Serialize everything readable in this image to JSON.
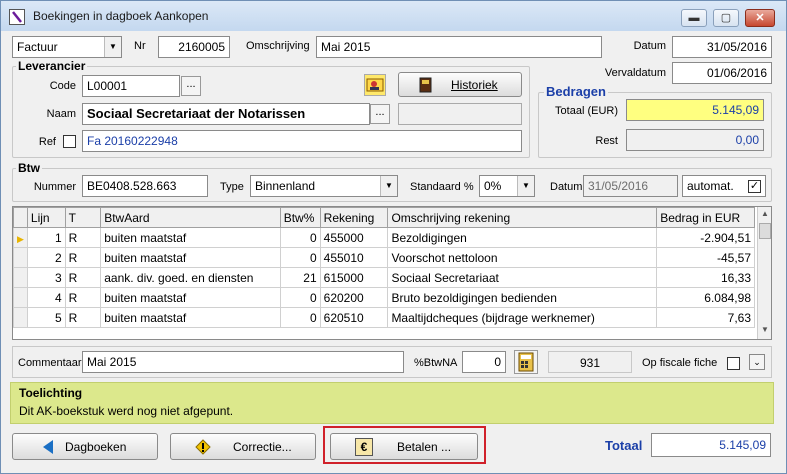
{
  "window": {
    "title": "Boekingen in dagboek Aankopen",
    "minimize": "▬",
    "restore": "▢",
    "close": "✕"
  },
  "header": {
    "doc_type": "Factuur",
    "nr_label": "Nr",
    "nr_value": "2160005",
    "omschrijving_label": "Omschrijving",
    "omschrijving_value": "Mai 2015",
    "datum_label": "Datum",
    "datum_value": "31/05/2016",
    "vervaldatum_label": "Vervaldatum",
    "vervaldatum_value": "01/06/2016"
  },
  "leverancier": {
    "title": "Leverancier",
    "code_label": "Code",
    "code_value": "L00001",
    "naam_label": "Naam",
    "naam_value": "Sociaal Secretariaat der Notarissen",
    "ref_label": "Ref",
    "ref_value": "Fa 20160222948",
    "historiek_label": "Historiek",
    "ellipsis": "..."
  },
  "bedragen": {
    "title": "Bedragen",
    "totaal_label": "Totaal (EUR)",
    "totaal_value": "5.145,09",
    "rest_label": "Rest",
    "rest_value": "0,00"
  },
  "btw": {
    "title": "Btw",
    "nummer_label": "Nummer",
    "nummer_value": "BE0408.528.663",
    "type_label": "Type",
    "type_value": "Binnenland",
    "standaard_label": "Standaard %",
    "standaard_value": "0%",
    "datum_label": "Datum",
    "datum_value": "31/05/2016",
    "automat_label": "automat.",
    "automat_check": "✓"
  },
  "table": {
    "headers": [
      "Lijn",
      "T",
      "BtwAard",
      "Btw%",
      "Rekening",
      "Omschrijving rekening",
      "Bedrag in EUR"
    ],
    "rows": [
      [
        "1",
        "R",
        "buiten maatstaf",
        "0",
        "455000",
        "Bezoldigingen",
        "-2.904,51"
      ],
      [
        "2",
        "R",
        "buiten maatstaf",
        "0",
        "455010",
        "Voorschot nettoloon",
        "-45,57"
      ],
      [
        "3",
        "R",
        "aank. div. goed. en diensten",
        "21",
        "615000",
        "Sociaal Secretariaat",
        "16,33"
      ],
      [
        "4",
        "R",
        "buiten maatstaf",
        "0",
        "620200",
        "Bruto bezoldigingen bedienden",
        "6.084,98"
      ],
      [
        "5",
        "R",
        "buiten maatstaf",
        "0",
        "620510",
        "Maaltijdcheques (bijdrage werknemer)",
        "7,63"
      ]
    ]
  },
  "footer": {
    "commentaar_label": "Commentaar",
    "commentaar_value": "Mai 2015",
    "btwna_label": "%BtwNA",
    "btwna_value": "0",
    "count": "931",
    "fiscale_label": "Op fiscale fiche"
  },
  "toelichting": {
    "title": "Toelichting",
    "text": "Dit AK-boekstuk werd nog niet afgepunt."
  },
  "buttons": {
    "dagboeken": "Dagboeken",
    "correctie": "Correctie...",
    "betalen": "Betalen ...",
    "totaal_label": "Totaal",
    "totaal_value": "5.145,09"
  },
  "colors": {
    "highlight_border": "#d0212a",
    "toelichting_bg": "#dce88c",
    "totaal_bg": "#ffff80",
    "link_blue": "#1b3fa8"
  }
}
